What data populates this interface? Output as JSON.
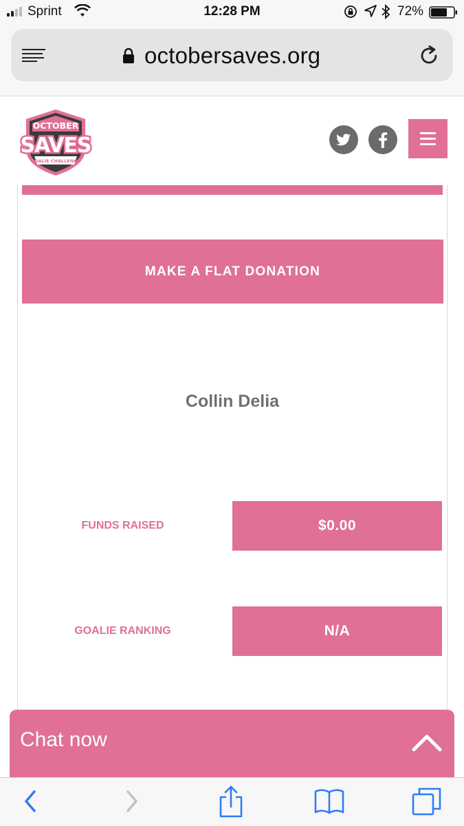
{
  "status_bar": {
    "carrier": "Sprint",
    "time": "12:28 PM",
    "battery_percent": "72%",
    "battery_level": 0.72,
    "icons": [
      "signal-icon",
      "wifi-icon",
      "rotation-lock-icon",
      "location-icon",
      "bluetooth-icon",
      "battery-icon"
    ]
  },
  "browser": {
    "url": "octobersaves.org",
    "icons": [
      "reader-mode-icon",
      "padlock-icon",
      "reload-icon"
    ],
    "toolbar_icons": [
      "back-icon",
      "forward-icon",
      "share-icon",
      "bookmarks-icon",
      "tabs-icon"
    ]
  },
  "site": {
    "logo": {
      "line1": "OCTOBER",
      "line2": "SAVES",
      "line3": "GOALIE CHALLENGE"
    },
    "social_icons": [
      "twitter-icon",
      "facebook-icon"
    ],
    "menu_icon": "hamburger-icon"
  },
  "donation": {
    "button_label": "MAKE A FLAT DONATION"
  },
  "goalie": {
    "name": "Collin Delia",
    "stats": [
      {
        "label": "FUNDS RAISED",
        "value": "$0.00"
      },
      {
        "label": "GOALIE RANKING",
        "value": "N/A"
      }
    ]
  },
  "chat": {
    "label": "Chat now"
  },
  "colors": {
    "brand_pink": "#e07095",
    "social_grey": "#6b6b6b",
    "name_grey": "#707070",
    "ios_blue": "#2f7cf6"
  }
}
